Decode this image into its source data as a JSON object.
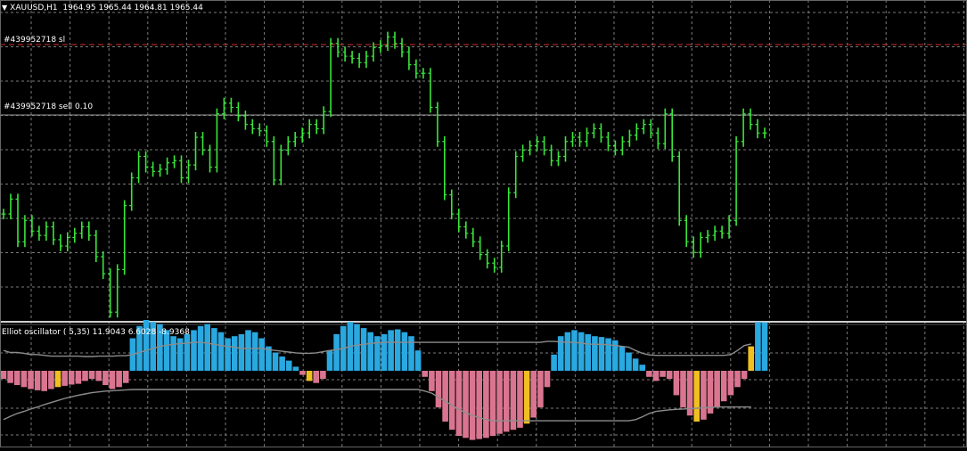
{
  "header": {
    "symbol_text": "XAUUSD,H1",
    "ohlc_text": "1964.95 1965.44 1964.81 1965.44",
    "dropdown_icon": "triangle-down-icon"
  },
  "price_lines": {
    "sl_label": "#439952718 sl",
    "order_label": "#439952718 sell 0.10",
    "sl_color": "#d03030",
    "order_color": "#9a9a9a"
  },
  "indicator": {
    "label": "Elliot oscillator ( 5,35) 11.9043 6.6028 -8.9368",
    "positive_color": "#2aa8e0",
    "negative_color": "#d97590",
    "highlight_color": "#f0c020",
    "band_color": "#8c8c8c"
  },
  "colors": {
    "background": "#000000",
    "grid": "#7a7a7a",
    "candles": "#39e639"
  },
  "chart_data": {
    "type": "line",
    "grid": true,
    "price_pane": {
      "series": [
        {
          "values": [
            1928,
            1935,
            1915,
            1925,
            1920,
            1918,
            1922,
            1916,
            1913,
            1917,
            1919,
            1922,
            1918,
            1908,
            1900,
            1882,
            1902,
            1932,
            1945,
            1955,
            1950,
            1948,
            1949,
            1952,
            1953,
            1945,
            1951,
            1964,
            1958,
            1950,
            1975,
            1980,
            1978,
            1974,
            1970,
            1968,
            1967,
            1962,
            1944,
            1958,
            1962,
            1964,
            1966,
            1970,
            1968,
            1976,
            2008,
            2004,
            2002,
            2001,
            1999,
            2002,
            2006,
            2007,
            2011,
            2008,
            2004,
            1998,
            1994,
            1994,
            1978,
            1962,
            1937,
            1928,
            1922,
            1919,
            1915,
            1909,
            1905,
            1903,
            1913,
            1938,
            1955,
            1958,
            1960,
            1962,
            1958,
            1953,
            1955,
            1962,
            1964,
            1962,
            1966,
            1968,
            1964,
            1960,
            1958,
            1962,
            1965,
            1968,
            1970,
            1966,
            1961,
            1975,
            1955,
            1925,
            1915,
            1910,
            1917,
            1918,
            1920,
            1919,
            1925,
            1962,
            1975,
            1970,
            1966,
            1966
          ]
        }
      ],
      "ylim": [
        1880,
        2020
      ]
    },
    "oscillator_pane": {
      "series": [
        {
          "name": "histogram",
          "values": [
            -2,
            -3,
            -3.5,
            -4,
            -4.5,
            -4.8,
            -5,
            -4.5,
            -4,
            -3.7,
            -3.4,
            -3.2,
            -2.5,
            -2,
            -2.5,
            -3.5,
            -4.5,
            -4,
            -3,
            8,
            11,
            12.5,
            12,
            11.5,
            10,
            8.5,
            8,
            9,
            10,
            11,
            11.5,
            10.5,
            9.5,
            8,
            8.5,
            9,
            10,
            9.5,
            8,
            6,
            4.5,
            3.5,
            2.5,
            1,
            -1,
            -2.5,
            -3,
            -2,
            5,
            9,
            11,
            12,
            11.5,
            10.5,
            9.5,
            8.5,
            9,
            10,
            10.2,
            9.5,
            8.5,
            5,
            -1.5,
            -5,
            -9,
            -12.5,
            -14.5,
            -16,
            -16.5,
            -17,
            -16.8,
            -16.5,
            -16,
            -15.5,
            -15,
            -14.5,
            -14,
            -13,
            -11.5,
            -9,
            -4,
            4,
            8.5,
            9.5,
            10,
            9.5,
            9,
            8.5,
            8.3,
            8,
            7.5,
            6,
            4.5,
            3,
            1.5,
            -1.5,
            -2.5,
            -1.5,
            -2,
            -6,
            -9,
            -11,
            -12.5,
            -12,
            -10.5,
            -9,
            -7.5,
            -6,
            -4,
            -2,
            6,
            12,
            11.9
          ]
        },
        {
          "name": "upper band",
          "values": [
            5,
            4.5,
            4.5,
            4.3,
            4,
            4,
            3.8,
            3.6,
            3.6,
            3.6,
            3.6,
            3.6,
            3.5,
            3.5,
            3.6,
            3.6,
            3.6,
            3.7,
            3.7,
            4,
            4.5,
            5,
            5.5,
            6,
            6.3,
            6.5,
            6.7,
            6.8,
            7,
            7,
            6.8,
            6.5,
            6.2,
            6,
            5.8,
            5.5,
            5.5,
            5.5,
            5.5,
            5.2,
            5,
            4.8,
            4.6,
            4.4,
            4.3,
            4.3,
            4.4,
            4.7,
            5,
            5.2,
            5.5,
            6,
            6.3,
            6.5,
            6.7,
            6.9,
            7,
            7,
            7,
            7,
            7,
            7,
            7,
            7,
            7,
            7,
            7,
            7,
            7,
            7,
            7,
            7,
            7,
            7,
            7,
            7,
            7,
            7,
            7,
            7,
            7.2,
            7.2,
            7.1,
            7,
            7,
            6.8,
            6.6,
            6.5,
            6.5,
            6.4,
            6.2,
            6,
            5.8,
            5,
            4.3,
            3.9,
            3.8,
            3.8,
            3.8,
            3.8,
            3.8,
            3.8,
            3.8,
            3.8,
            3.8,
            3.8,
            3.8,
            4,
            5,
            6.2,
            6.6
          ]
        },
        {
          "name": "lower band",
          "values": [
            -12,
            -11.2,
            -10.5,
            -10,
            -9.4,
            -8.9,
            -8.3,
            -7.8,
            -7.3,
            -6.8,
            -6.4,
            -6,
            -5.7,
            -5.4,
            -5.2,
            -5,
            -4.9,
            -4.8,
            -4.7,
            -4.6,
            -4.6,
            -4.6,
            -4.6,
            -4.6,
            -4.6,
            -4.6,
            -4.6,
            -4.6,
            -4.6,
            -4.6,
            -4.6,
            -4.6,
            -4.6,
            -4.6,
            -4.6,
            -4.6,
            -4.6,
            -4.6,
            -4.6,
            -4.6,
            -4.6,
            -4.6,
            -4.6,
            -4.6,
            -4.6,
            -4.6,
            -4.6,
            -4.6,
            -4.6,
            -4.6,
            -4.6,
            -4.6,
            -4.6,
            -4.6,
            -4.6,
            -4.6,
            -4.6,
            -4.6,
            -4.6,
            -4.6,
            -4.6,
            -4.6,
            -5,
            -5.5,
            -6.5,
            -7.5,
            -8.5,
            -9.5,
            -10.3,
            -11,
            -11.5,
            -12,
            -12.3,
            -12.3,
            -12.3,
            -12.3,
            -12.3,
            -12.3,
            -12.3,
            -12.3,
            -12.3,
            -12.3,
            -12.3,
            -12.3,
            -12.3,
            -12.3,
            -12.3,
            -12.3,
            -12.3,
            -12.3,
            -12.3,
            -12.3,
            -12.3,
            -12,
            -11.3,
            -10.5,
            -10,
            -9.8,
            -9.6,
            -9.5,
            -9.4,
            -9.3,
            -9.2,
            -9.1,
            -9,
            -8.9,
            -8.9,
            -8.9,
            -8.9,
            -8.9,
            -8.9
          ]
        }
      ],
      "highlight_bars": [
        8,
        45,
        77,
        102,
        110
      ],
      "ylim": [
        -18,
        14
      ]
    }
  }
}
